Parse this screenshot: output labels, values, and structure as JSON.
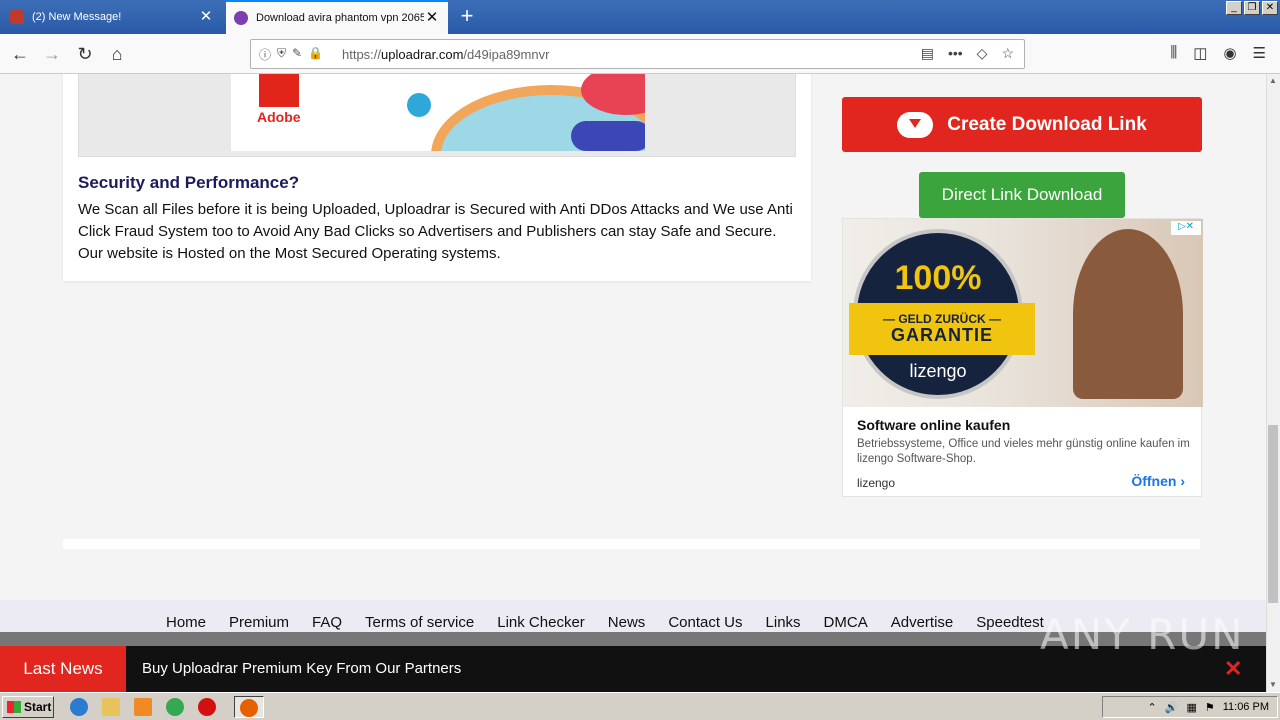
{
  "browser": {
    "tabs": [
      {
        "label": "(2) New Message!",
        "favicon_color": "#c0392b"
      },
      {
        "label": "Download avira phantom vpn 2065",
        "favicon_color": "#7b3fb0"
      }
    ],
    "url": {
      "prefix": "https://",
      "domain": "uploadrar.com",
      "path": "/d49ipa89mnvr"
    }
  },
  "page": {
    "adobe_label": "Adobe",
    "security_title": "Security and Performance?",
    "security_text": "We Scan all Files before it is being Uploaded, Uploadrar is Secured with Anti DDos Attacks and We use Anti Click Fraud System too to Avoid Any Bad Clicks so Advertisers and Publishers can stay Safe and Secure. Our website is Hosted on the Most Secured Operating systems.",
    "create_download_link": "Create Download Link",
    "direct_link_download": "Direct Link Download",
    "ad": {
      "badge_percent": "100%",
      "badge_line1": "— GELD ZURÜCK —",
      "badge_line2": "GARANTIE",
      "badge_brand": "lizengo",
      "title": "Software online kaufen",
      "description": "Betriebssysteme, Office und vieles mehr günstig online kaufen im lizengo Software-Shop.",
      "brand": "lizengo",
      "cta": "Öffnen"
    },
    "footer_links": [
      "Home",
      "Premium",
      "FAQ",
      "Terms of service",
      "Link Checker",
      "News",
      "Contact Us",
      "Links",
      "DMCA",
      "Advertise",
      "Speedtest"
    ],
    "news": {
      "label": "Last News",
      "text": "Buy Uploadrar Premium Key From Our Partners"
    }
  },
  "watermark": "ANY RUN",
  "taskbar": {
    "start": "Start",
    "clock": "11:06 PM"
  },
  "colors": {
    "red": "#e0261e",
    "green": "#3ca43c",
    "firefox_blue": "#0a84ff"
  }
}
